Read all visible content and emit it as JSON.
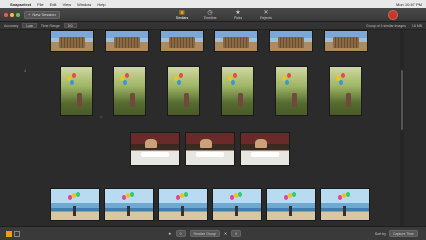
{
  "menubar": {
    "app_name": "Snapselect",
    "items": [
      "File",
      "Edit",
      "View",
      "Window",
      "Help"
    ],
    "clock": "Mon 10:57 PM"
  },
  "toolbar": {
    "new_session": "New Session",
    "tabs": [
      {
        "label": "Similars",
        "icon": "similars-icon",
        "active": true
      },
      {
        "label": "Timeline",
        "icon": "timeline-icon",
        "active": false
      },
      {
        "label": "Picks",
        "icon": "star-icon",
        "active": false
      },
      {
        "label": "Rejects",
        "icon": "x-icon",
        "active": false
      }
    ]
  },
  "filterbar": {
    "accuracy_label": "Accuracy",
    "accuracy_value": "Low",
    "time_range_label": "Time Range",
    "time_range_value": "0:0",
    "group_info": "Group of 4 similar images",
    "size_info": "16 MB"
  },
  "groups": [
    {
      "number": "",
      "kind": "basket",
      "count": 6
    },
    {
      "number": "4",
      "kind": "girl",
      "count": 6
    },
    {
      "number": "",
      "kind": "dining",
      "count": 3
    },
    {
      "number": "",
      "kind": "beach",
      "count": 6
    }
  ],
  "bottombar": {
    "count": "0",
    "arrange_label": "Realize Group",
    "count2": "0",
    "sort_label": "Sort by",
    "sort_value": "Capture Time"
  },
  "colors": {
    "accent": "#f39c12",
    "record": "#c0392b"
  }
}
